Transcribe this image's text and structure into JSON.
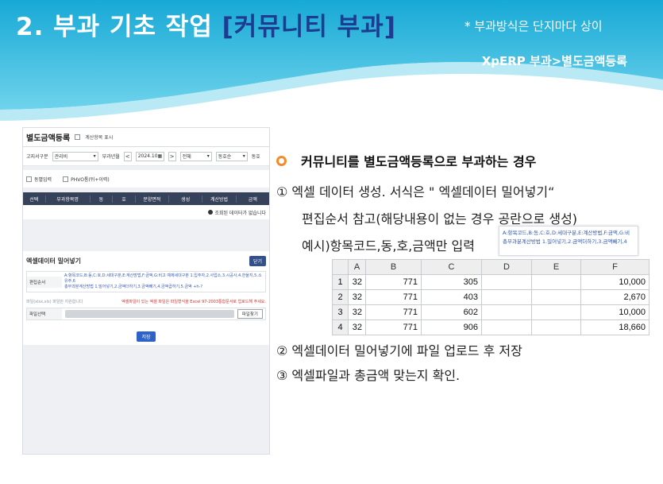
{
  "header": {
    "title_prefix": "2. 부과 기초 작업 ",
    "title_highlight": "[커뮤니티 부과]",
    "note": "* 부과방식은 단지마다 상이",
    "path": "XpERP 부과>별도금액등록",
    "colors": {
      "banner_top": "#17a9d6",
      "banner_mid": "#5ccbe8",
      "highlight": "#1e3c8f"
    }
  },
  "erp": {
    "title": "별도금액등록",
    "title_option": "계산항목 표시",
    "filter": {
      "label_1": "고지서구분",
      "select_1": "관리비",
      "label_2": "부과년월",
      "prev": "<",
      "month": "2024.10",
      "next": ">",
      "select_3": "전체",
      "select_4": "동호순",
      "label_5": "동호"
    },
    "options": {
      "opt_1": "동별입력",
      "opt_2": "PHVO통(뒤+이력)"
    },
    "grid_headers": [
      "선택",
      "부과항목명",
      "동",
      "호",
      "분양면적",
      "생성",
      "계산방법",
      "금액"
    ],
    "grid_message": "조회된 데이터가 없습니다",
    "upload": {
      "title": "엑셀데이터 밀어넣기",
      "close_button": "닫기",
      "row_label": "편집순서",
      "row_value_1": "A:항목코드,B:동,C:호,D:세대구분,E:계산방법,F:금액,G:비고 예제세대구분 1.입주자,2.사업소,3.시공사,4.한울지,5.소유주,6",
      "row_value_2": "총부과분계산방법 1.밀어넣기,2.금액더하기,3.금액빼기,4.금액곱하기,5.금액 +h-?",
      "msg_left": "파일(xlsx,xls) 파일만 지원합니다",
      "msg_right": "엑셀파일이 있는 엑셀 파일은 파일형식을 Excel 97-2003통합문서로 업로드해 주세요.",
      "file_label": "파일선택",
      "file_button": "파일찾기",
      "save_button": "저장"
    }
  },
  "content": {
    "section_title": "커뮤니티를 별도금액등록으로 부과하는 경우",
    "step1_line1": "①  엑셀 데이터 생성. 서식은  \" 엑셀데이터 밀어넣기“",
    "step1_line2": "편집순서 참고(해당내용이 없는 경우 공란으로 생성)",
    "step1_line3": "예시)항목코드,동,호,금액만 입력",
    "snippet_line1": "A:항목코드,B:동,C:호,D:세대구분,E:계산방법,F:금액,G:비",
    "snippet_line2": "총부과분계산방법 1.밀어넣기,2.금액더하기,3.금액빼기,4",
    "step2": "②  엑셀데이터 밀어넣기에 파일 업로드 후 저장",
    "step3": "③  엑셀파일과 총금액 맞는지 확인."
  },
  "excel": {
    "columns": [
      "",
      "A",
      "B",
      "C",
      "D",
      "E",
      "F"
    ],
    "rows": [
      {
        "n": "1",
        "a": "32",
        "b": "771",
        "c": "305",
        "d": "",
        "e": "",
        "f": "10,000"
      },
      {
        "n": "2",
        "a": "32",
        "b": "771",
        "c": "403",
        "d": "",
        "e": "",
        "f": "2,670"
      },
      {
        "n": "3",
        "a": "32",
        "b": "771",
        "c": "602",
        "d": "",
        "e": "",
        "f": "10,000"
      },
      {
        "n": "4",
        "a": "32",
        "b": "771",
        "c": "906",
        "d": "",
        "e": "",
        "f": "18,660"
      }
    ]
  }
}
